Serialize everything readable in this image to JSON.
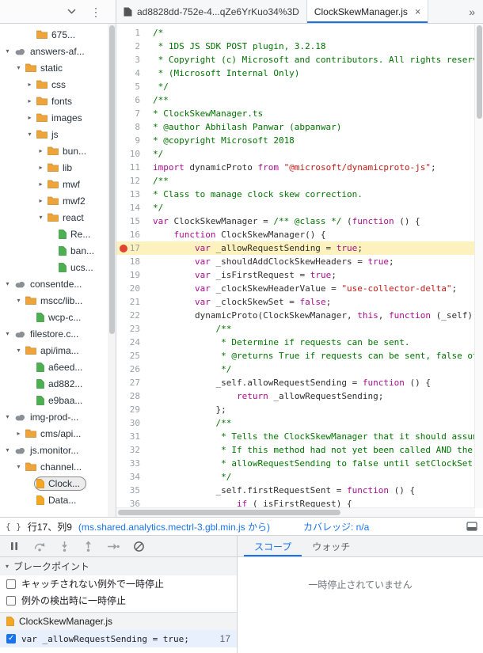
{
  "colors": {
    "accent": "#1a73e8",
    "breakpoint_red": "#e0432f",
    "highlight_yellow": "#fdf2bd"
  },
  "tabbar": {
    "tabs": [
      {
        "label": "ad8828dd-752e-4...qZe6YrKuo34%3D",
        "active": false
      },
      {
        "label": "ClockSkewManager.js",
        "active": true,
        "close": "×"
      }
    ],
    "overflow": "»"
  },
  "tree": {
    "items": [
      {
        "level": 2,
        "arrow": "",
        "icon": "folder",
        "label": "675..."
      },
      {
        "level": 0,
        "arrow": "down",
        "icon": "cloud",
        "label": "answers-af..."
      },
      {
        "level": 1,
        "arrow": "down",
        "icon": "folder",
        "label": "static"
      },
      {
        "level": 2,
        "arrow": "right",
        "icon": "folder",
        "label": "css"
      },
      {
        "level": 2,
        "arrow": "right",
        "icon": "folder",
        "label": "fonts"
      },
      {
        "level": 2,
        "arrow": "right",
        "icon": "folder",
        "label": "images"
      },
      {
        "level": 2,
        "arrow": "down",
        "icon": "folder",
        "label": "js"
      },
      {
        "level": 3,
        "arrow": "right",
        "icon": "folder",
        "label": "bun..."
      },
      {
        "level": 3,
        "arrow": "right",
        "icon": "folder",
        "label": "lib"
      },
      {
        "level": 3,
        "arrow": "right",
        "icon": "folder",
        "label": "mwf"
      },
      {
        "level": 3,
        "arrow": "right",
        "icon": "folder",
        "label": "mwf2"
      },
      {
        "level": 3,
        "arrow": "down",
        "icon": "folder",
        "label": "react"
      },
      {
        "level": 4,
        "arrow": "",
        "icon": "file-green",
        "label": "Re..."
      },
      {
        "level": 4,
        "arrow": "",
        "icon": "file-green",
        "label": "ban..."
      },
      {
        "level": 4,
        "arrow": "",
        "icon": "file-green",
        "label": "ucs..."
      },
      {
        "level": 0,
        "arrow": "down",
        "icon": "cloud",
        "label": "consentde..."
      },
      {
        "level": 1,
        "arrow": "down",
        "icon": "folder",
        "label": "mscc/lib..."
      },
      {
        "level": 2,
        "arrow": "",
        "icon": "file-green",
        "label": "wcp-c..."
      },
      {
        "level": 0,
        "arrow": "down",
        "icon": "cloud",
        "label": "filestore.c..."
      },
      {
        "level": 1,
        "arrow": "down",
        "icon": "folder",
        "label": "api/ima..."
      },
      {
        "level": 2,
        "arrow": "",
        "icon": "file-green",
        "label": "a6eed..."
      },
      {
        "level": 2,
        "arrow": "",
        "icon": "file-green",
        "label": "ad882..."
      },
      {
        "level": 2,
        "arrow": "",
        "icon": "file-green",
        "label": "e9baa..."
      },
      {
        "level": 0,
        "arrow": "down",
        "icon": "cloud",
        "label": "img-prod-..."
      },
      {
        "level": 1,
        "arrow": "right",
        "icon": "folder",
        "label": "cms/api..."
      },
      {
        "level": 0,
        "arrow": "down",
        "icon": "cloud",
        "label": "js.monitor..."
      },
      {
        "level": 1,
        "arrow": "down",
        "icon": "folder",
        "label": "channel..."
      },
      {
        "level": 2,
        "arrow": "",
        "icon": "file-orange",
        "label": "Clock...",
        "selected": true
      },
      {
        "level": 2,
        "arrow": "",
        "icon": "file-orange",
        "label": "Data..."
      }
    ]
  },
  "editor": {
    "breakpoint_line": 17,
    "highlighted_line": 17,
    "lines": [
      {
        "n": 1,
        "t": [
          [
            "c",
            "/*"
          ]
        ]
      },
      {
        "n": 2,
        "t": [
          [
            "c",
            " * 1DS JS SDK POST plugin, 3.2.18"
          ]
        ]
      },
      {
        "n": 3,
        "t": [
          [
            "c",
            " * Copyright (c) Microsoft and contributors. All rights reserved."
          ]
        ]
      },
      {
        "n": 4,
        "t": [
          [
            "c",
            " * (Microsoft Internal Only)"
          ]
        ]
      },
      {
        "n": 5,
        "t": [
          [
            "c",
            " */"
          ]
        ]
      },
      {
        "n": 6,
        "t": [
          [
            "c",
            "/**"
          ]
        ]
      },
      {
        "n": 7,
        "t": [
          [
            "c",
            "* ClockSkewManager.ts"
          ]
        ]
      },
      {
        "n": 8,
        "t": [
          [
            "c",
            "* @author Abhilash Panwar (abpanwar)"
          ]
        ]
      },
      {
        "n": 9,
        "t": [
          [
            "c",
            "* @copyright Microsoft 2018"
          ]
        ]
      },
      {
        "n": 10,
        "t": [
          [
            "c",
            "*/"
          ]
        ]
      },
      {
        "n": 11,
        "t": [
          [
            "k",
            "import"
          ],
          [
            "p",
            " dynamicProto "
          ],
          [
            "k",
            "from"
          ],
          [
            "p",
            " "
          ],
          [
            "s",
            "\"@microsoft/dynamicproto-js\""
          ],
          [
            "p",
            ";"
          ]
        ]
      },
      {
        "n": 12,
        "t": [
          [
            "c",
            "/**"
          ]
        ]
      },
      {
        "n": 13,
        "t": [
          [
            "c",
            "* Class to manage clock skew correction."
          ]
        ]
      },
      {
        "n": 14,
        "t": [
          [
            "c",
            "*/"
          ]
        ]
      },
      {
        "n": 15,
        "t": [
          [
            "k",
            "var"
          ],
          [
            "p",
            " ClockSkewManager = "
          ],
          [
            "c",
            "/** @class */"
          ],
          [
            "p",
            " ("
          ],
          [
            "k",
            "function"
          ],
          [
            "p",
            " () {"
          ]
        ]
      },
      {
        "n": 16,
        "t": [
          [
            "p",
            "    "
          ],
          [
            "k",
            "function"
          ],
          [
            "p",
            " ClockSkewManager() {"
          ]
        ]
      },
      {
        "n": 17,
        "t": [
          [
            "p",
            "        "
          ],
          [
            "k",
            "var"
          ],
          [
            "p",
            " _allowRequestSending = "
          ],
          [
            "k",
            "true"
          ],
          [
            "p",
            ";"
          ]
        ]
      },
      {
        "n": 18,
        "t": [
          [
            "p",
            "        "
          ],
          [
            "k",
            "var"
          ],
          [
            "p",
            " _shouldAddClockSkewHeaders = "
          ],
          [
            "k",
            "true"
          ],
          [
            "p",
            ";"
          ]
        ]
      },
      {
        "n": 19,
        "t": [
          [
            "p",
            "        "
          ],
          [
            "k",
            "var"
          ],
          [
            "p",
            " _isFirstRequest = "
          ],
          [
            "k",
            "true"
          ],
          [
            "p",
            ";"
          ]
        ]
      },
      {
        "n": 20,
        "t": [
          [
            "p",
            "        "
          ],
          [
            "k",
            "var"
          ],
          [
            "p",
            " _clockSkewHeaderValue = "
          ],
          [
            "s",
            "\"use-collector-delta\""
          ],
          [
            "p",
            ";"
          ]
        ]
      },
      {
        "n": 21,
        "t": [
          [
            "p",
            "        "
          ],
          [
            "k",
            "var"
          ],
          [
            "p",
            " _clockSkewSet = "
          ],
          [
            "k",
            "false"
          ],
          [
            "p",
            ";"
          ]
        ]
      },
      {
        "n": 22,
        "t": [
          [
            "p",
            "        dynamicProto(ClockSkewManager, "
          ],
          [
            "k",
            "this"
          ],
          [
            "p",
            ", "
          ],
          [
            "k",
            "function"
          ],
          [
            "p",
            " (_self) {"
          ]
        ]
      },
      {
        "n": 23,
        "t": [
          [
            "c",
            "            /**"
          ]
        ]
      },
      {
        "n": 24,
        "t": [
          [
            "c",
            "             * Determine if requests can be sent."
          ]
        ]
      },
      {
        "n": 25,
        "t": [
          [
            "c",
            "             * @returns True if requests can be sent, false otherwise."
          ]
        ]
      },
      {
        "n": 26,
        "t": [
          [
            "c",
            "             */"
          ]
        ]
      },
      {
        "n": 27,
        "t": [
          [
            "p",
            "            _self.allowRequestSending = "
          ],
          [
            "k",
            "function"
          ],
          [
            "p",
            " () {"
          ]
        ]
      },
      {
        "n": 28,
        "t": [
          [
            "p",
            "                "
          ],
          [
            "k",
            "return"
          ],
          [
            "p",
            " _allowRequestSending;"
          ]
        ]
      },
      {
        "n": 29,
        "t": [
          [
            "p",
            "            };"
          ]
        ]
      },
      {
        "n": 30,
        "t": [
          [
            "c",
            "            /**"
          ]
        ]
      },
      {
        "n": 31,
        "t": [
          [
            "c",
            "             * Tells the ClockSkewManager that it should assume that"
          ]
        ]
      },
      {
        "n": 32,
        "t": [
          [
            "c",
            "             * If this method had not yet been called AND the response"
          ]
        ]
      },
      {
        "n": 33,
        "t": [
          [
            "c",
            "             * allowRequestSending to false until setClockSet() is"
          ]
        ]
      },
      {
        "n": 34,
        "t": [
          [
            "c",
            "             */"
          ]
        ]
      },
      {
        "n": 35,
        "t": [
          [
            "p",
            "            _self.firstRequestSent = "
          ],
          [
            "k",
            "function"
          ],
          [
            "p",
            " () {"
          ]
        ]
      },
      {
        "n": 36,
        "t": [
          [
            "p",
            "                "
          ],
          [
            "k",
            "if"
          ],
          [
            "p",
            " (_isFirstRequest) {"
          ]
        ]
      }
    ]
  },
  "statusbar": {
    "pretty_print": "{ }",
    "position": "行17、列9",
    "source_origin": "(ms.shared.analytics.mectrl-3.gbl.min.js から)",
    "coverage": "カバレッジ: n/a"
  },
  "debugger": {
    "tabs": [
      {
        "label": "スコープ",
        "active": true
      },
      {
        "label": "ウォッチ",
        "active": false
      }
    ],
    "not_paused_message": "一時停止されていません",
    "breakpoints": {
      "header": "ブレークポイント",
      "pause_uncaught": {
        "label": "キャッチされない例外で一時停止",
        "checked": false
      },
      "pause_caught": {
        "label": "例外の検出時に一時停止",
        "checked": false
      },
      "file": "ClockSkewManager.js",
      "entries": [
        {
          "checked": true,
          "code": "var _allowRequestSending = true;",
          "line": "17"
        }
      ]
    }
  }
}
